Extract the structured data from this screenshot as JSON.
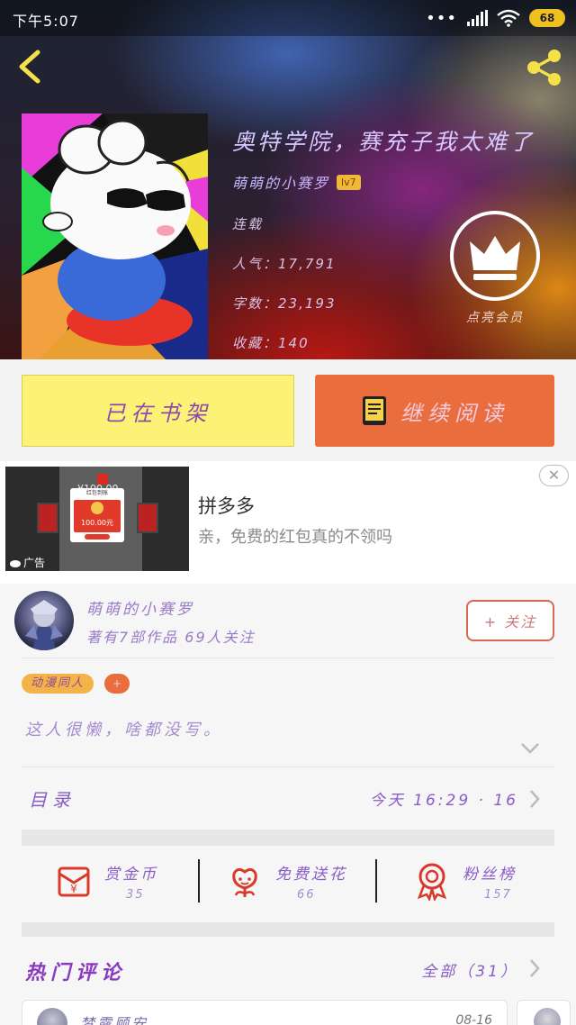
{
  "status_bar": {
    "time": "下午5:07",
    "signal": "•••",
    "battery": "68"
  },
  "book": {
    "title": "奥特学院，赛充子我太难了",
    "author": "萌萌的小赛罗",
    "author_level": "lv7",
    "status": "连载",
    "popularity": "人气：17,791",
    "word_count": "字数：23,193",
    "collections": "收藏：140",
    "vip_label": "点亮会员"
  },
  "actions": {
    "shelf_label": "已在书架",
    "read_label": "继续阅读"
  },
  "ad": {
    "title": "拼多多",
    "description": "亲，免费的红包真的不领吗",
    "tag": "广告",
    "thumb_amount": "¥100.00",
    "thumb_card_title": "红包到账",
    "thumb_card_value": "100.00元",
    "close": "✕"
  },
  "author_card": {
    "name": "萌萌的小赛罗",
    "stats": "著有7部作品 69人关注",
    "follow_label": "+ 关注",
    "tag": "动漫同人",
    "tag_add": "+",
    "bio": "这人很懒，啥都没写。"
  },
  "toc": {
    "label": "目录",
    "updated": "今天 16:29 · 16"
  },
  "features": [
    {
      "label": "赏金币",
      "count": "35",
      "icon": "red-envelope-icon"
    },
    {
      "label": "免费送花",
      "count": "66",
      "icon": "flower-icon"
    },
    {
      "label": "粉丝榜",
      "count": "157",
      "icon": "medal-icon"
    }
  ],
  "hot_comments": {
    "label": "热门评论",
    "all_label": "全部（31）"
  },
  "comments": [
    {
      "name": "梦露顾安",
      "date": "08-16"
    }
  ],
  "colors": {
    "accent_orange": "#ea6d3d",
    "shelf_yellow": "#fbf276",
    "text_purple": "#8a5cc8",
    "icon_red": "#d9382a"
  }
}
